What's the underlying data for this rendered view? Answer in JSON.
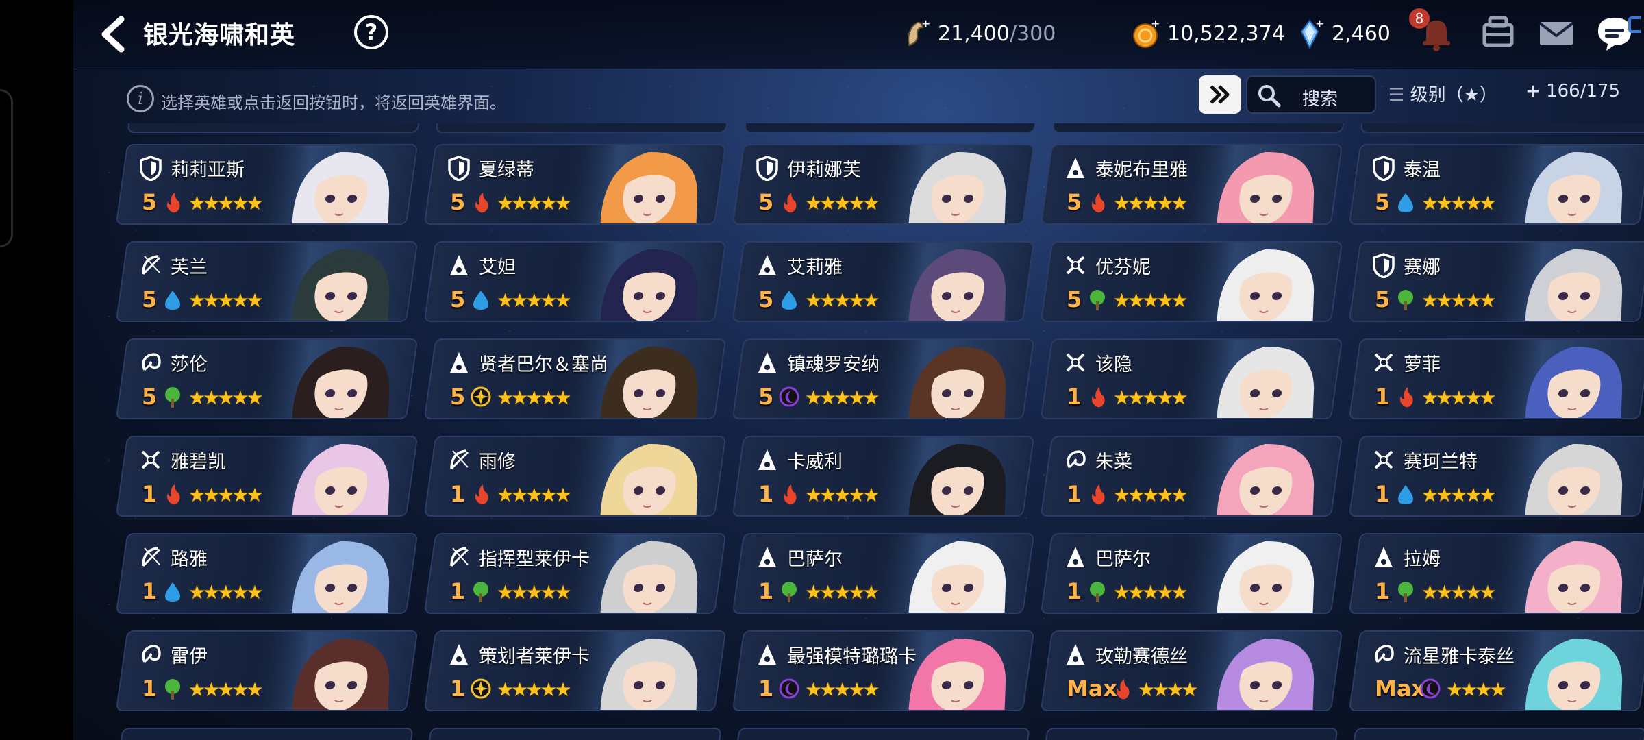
{
  "header": {
    "title": "银光海啸和英",
    "help_label": "?",
    "stamina": {
      "value": "21,400",
      "max": "/300"
    },
    "gold": "10,522,374",
    "crystal": "2,460",
    "notification_count": "8"
  },
  "subbar": {
    "info_text": "选择英雄或点击返回按钮时，将返回英雄界面。",
    "search_label": "搜索",
    "filter_label": "级别（★）",
    "hero_count": "166/175"
  },
  "colors": {
    "fire": "#e8452a",
    "water": "#2f9de6",
    "nature": "#4cb63c",
    "light": "#f2c12e",
    "dark": "#8a3fd9"
  },
  "heroes": [
    {
      "name": "莉莉亚斯",
      "class": "knight",
      "level": "5",
      "element": "fire",
      "stars": 5,
      "hair": "#e8e6ee"
    },
    {
      "name": "夏绿蒂",
      "class": "knight",
      "level": "5",
      "element": "fire",
      "stars": 5,
      "hair": "#f29a48"
    },
    {
      "name": "伊莉娜芙",
      "class": "knight",
      "level": "5",
      "element": "fire",
      "stars": 5,
      "hair": "#dcdcdc"
    },
    {
      "name": "泰妮布里雅",
      "class": "mage",
      "level": "5",
      "element": "fire",
      "stars": 5,
      "hair": "#f49ab0"
    },
    {
      "name": "泰温",
      "class": "knight",
      "level": "5",
      "element": "water",
      "stars": 5,
      "hair": "#c8d4e6"
    },
    {
      "name": "芙兰",
      "class": "ranger",
      "level": "5",
      "element": "water",
      "stars": 5,
      "hair": "#2b3a3a"
    },
    {
      "name": "艾妲",
      "class": "mage",
      "level": "5",
      "element": "water",
      "stars": 5,
      "hair": "#23244f"
    },
    {
      "name": "艾莉雅",
      "class": "mage",
      "level": "5",
      "element": "water",
      "stars": 5,
      "hair": "#5b4a7a"
    },
    {
      "name": "优芬妮",
      "class": "warrior",
      "level": "5",
      "element": "nature",
      "stars": 5,
      "hair": "#eeeeee"
    },
    {
      "name": "赛娜",
      "class": "knight",
      "level": "5",
      "element": "nature",
      "stars": 5,
      "hair": "#cfcfd6"
    },
    {
      "name": "莎伦",
      "class": "healer",
      "level": "5",
      "element": "nature",
      "stars": 5,
      "hair": "#2a1e1e"
    },
    {
      "name": "贤者巴尔＆塞尚",
      "class": "mage",
      "level": "5",
      "element": "light",
      "stars": 5,
      "hair": "#3d2d1e"
    },
    {
      "name": "镇魂罗安纳",
      "class": "mage",
      "level": "5",
      "element": "dark",
      "stars": 5,
      "hair": "#5a3526"
    },
    {
      "name": "该隐",
      "class": "warrior",
      "level": "1",
      "element": "fire",
      "stars": 5,
      "hair": "#e6e6e6"
    },
    {
      "name": "萝菲",
      "class": "warrior",
      "level": "1",
      "element": "fire",
      "stars": 5,
      "hair": "#4b5fbf"
    },
    {
      "name": "雅碧凯",
      "class": "warrior",
      "level": "1",
      "element": "fire",
      "stars": 5,
      "hair": "#e9c6e6"
    },
    {
      "name": "雨修",
      "class": "ranger",
      "level": "1",
      "element": "fire",
      "stars": 5,
      "hair": "#efd79a"
    },
    {
      "name": "卡威利",
      "class": "mage",
      "level": "1",
      "element": "fire",
      "stars": 5,
      "hair": "#1b1b22"
    },
    {
      "name": "朱菜",
      "class": "healer",
      "level": "1",
      "element": "fire",
      "stars": 5,
      "hair": "#f4a5bb"
    },
    {
      "name": "赛珂兰特",
      "class": "warrior",
      "level": "1",
      "element": "water",
      "stars": 5,
      "hair": "#d6d6d6"
    },
    {
      "name": "路雅",
      "class": "ranger",
      "level": "1",
      "element": "water",
      "stars": 5,
      "hair": "#9ab8e6"
    },
    {
      "name": "指挥型莱伊卡",
      "class": "ranger",
      "level": "1",
      "element": "nature",
      "stars": 5,
      "hair": "#cfcfcf"
    },
    {
      "name": "巴萨尔",
      "class": "mage",
      "level": "1",
      "element": "nature",
      "stars": 5,
      "hair": "#f0f0f0"
    },
    {
      "name": "巴萨尔",
      "class": "mage",
      "level": "1",
      "element": "nature",
      "stars": 5,
      "hair": "#f0f0f0"
    },
    {
      "name": "拉姆",
      "class": "mage",
      "level": "1",
      "element": "nature",
      "stars": 5,
      "hair": "#f4b0c8"
    },
    {
      "name": "雷伊",
      "class": "healer",
      "level": "1",
      "element": "nature",
      "stars": 5,
      "hair": "#5a2e2a"
    },
    {
      "name": "策划者莱伊卡",
      "class": "mage",
      "level": "1",
      "element": "light",
      "stars": 5,
      "hair": "#d6d6d6"
    },
    {
      "name": "最强模特璐璐卡",
      "class": "mage",
      "level": "1",
      "element": "dark",
      "stars": 5,
      "hair": "#f277a8"
    },
    {
      "name": "玫勒赛德丝",
      "class": "mage",
      "level": "Max",
      "element": "fire",
      "stars": 4,
      "hair": "#b58ae0"
    },
    {
      "name": "流星雅卡泰丝",
      "class": "healer",
      "level": "Max",
      "element": "dark",
      "stars": 4,
      "hair": "#6fd3dc"
    }
  ]
}
